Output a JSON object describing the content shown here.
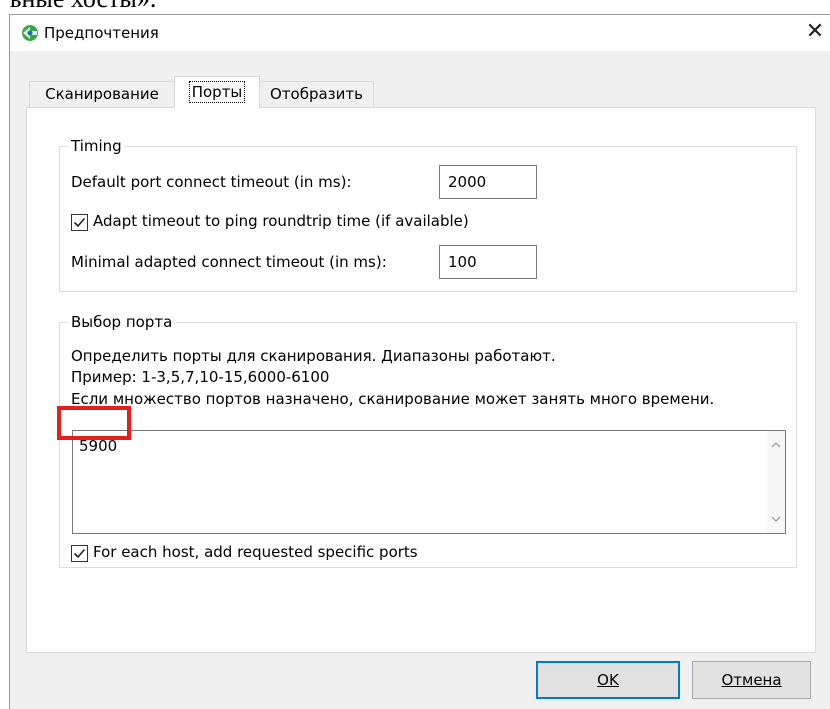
{
  "document": {
    "fragment_text": "ъные хосты»."
  },
  "window": {
    "title": "Предпочтения",
    "close_glyph": "✕"
  },
  "tabs": [
    {
      "label": "Сканирование",
      "active": false
    },
    {
      "label": "Порты",
      "active": true
    },
    {
      "label": "Отобразить",
      "active": false
    }
  ],
  "timing": {
    "group_title": "Timing",
    "connect_timeout_label": "Default port connect timeout (in ms):",
    "connect_timeout_value": "2000",
    "adapt_checkbox_label": "Adapt timeout to ping roundtrip time (if available)",
    "adapt_checked": true,
    "min_timeout_label": "Minimal adapted connect timeout (in ms):",
    "min_timeout_value": "100"
  },
  "port_selection": {
    "group_title": "Выбор порта",
    "description_line1": "Определить порты для сканирования. Диапазоны работают.",
    "description_line2": "Пример: 1-3,5,7,10-15,6000-6100",
    "description_line3": "Если множество портов назначено, сканирование может занять много времени.",
    "ports_value": "5900",
    "add_requested_label": "For each host, add requested specific ports",
    "add_requested_checked": true
  },
  "buttons": {
    "ok_label": "OK",
    "cancel_label": "Отмена"
  },
  "colors": {
    "highlight": "#e51e1e",
    "default_button_border": "#0078d7",
    "window_bg": "#f0f0f0"
  },
  "icons": {
    "app": "app-logo-icon",
    "close": "close-icon",
    "check": "checkmark-icon",
    "scroll_up": "chevron-up-icon",
    "scroll_down": "chevron-down-icon"
  }
}
